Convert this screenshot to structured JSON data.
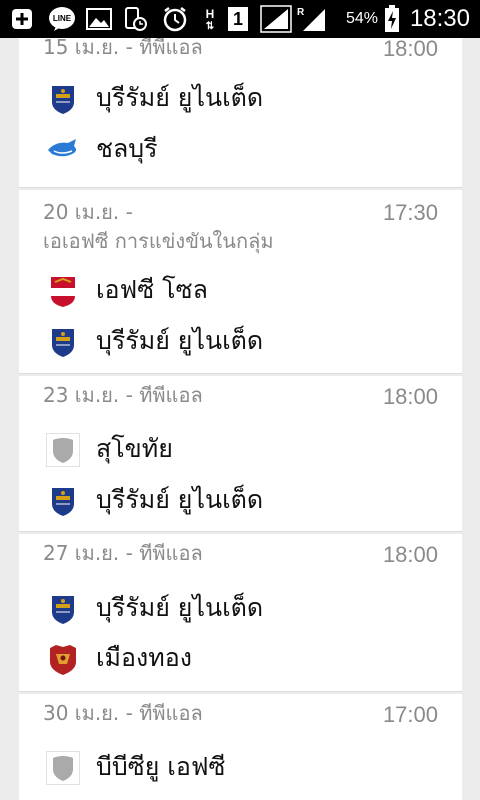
{
  "status_bar": {
    "battery_percent": "54%",
    "time": "18:30",
    "sim_label": "1",
    "signal_h_label": "H",
    "signal_r_label": "R",
    "line_app_label": "LINE"
  },
  "matches": [
    {
      "meta_line1": "15 เม.ย. - ทีพีแอล",
      "meta_line2": "",
      "time": "18:00",
      "teams": [
        {
          "name": "บุรีรัมย์ ยูไนเต็ด",
          "logo": "buriram-crest"
        },
        {
          "name": "ชลบุรี",
          "logo": "chonburi-shark"
        }
      ]
    },
    {
      "meta_line1": "20 เม.ย. -",
      "meta_line2": "เอเอฟซี การแข่งขันในกลุ่ม",
      "time": "17:30",
      "teams": [
        {
          "name": "เอฟซี โซล",
          "logo": "fc-seoul-crest"
        },
        {
          "name": "บุรีรัมย์ ยูไนเต็ด",
          "logo": "buriram-crest"
        }
      ]
    },
    {
      "meta_line1": "23 เม.ย. - ทีพีแอล",
      "meta_line2": "",
      "time": "18:00",
      "teams": [
        {
          "name": "สุโขทัย",
          "logo": "generic-shield"
        },
        {
          "name": "บุรีรัมย์ ยูไนเต็ด",
          "logo": "buriram-crest"
        }
      ]
    },
    {
      "meta_line1": "27 เม.ย. - ทีพีแอล",
      "meta_line2": "",
      "time": "18:00",
      "teams": [
        {
          "name": "บุรีรัมย์ ยูไนเต็ด",
          "logo": "buriram-crest"
        },
        {
          "name": "เมืองทอง",
          "logo": "muangthong-crest"
        }
      ]
    },
    {
      "meta_line1": "30 เม.ย. - ทีพีแอล",
      "meta_line2": "",
      "time": "17:00",
      "teams": [
        {
          "name": "บีบีซียู เอฟซี",
          "logo": "generic-shield"
        }
      ]
    }
  ]
}
